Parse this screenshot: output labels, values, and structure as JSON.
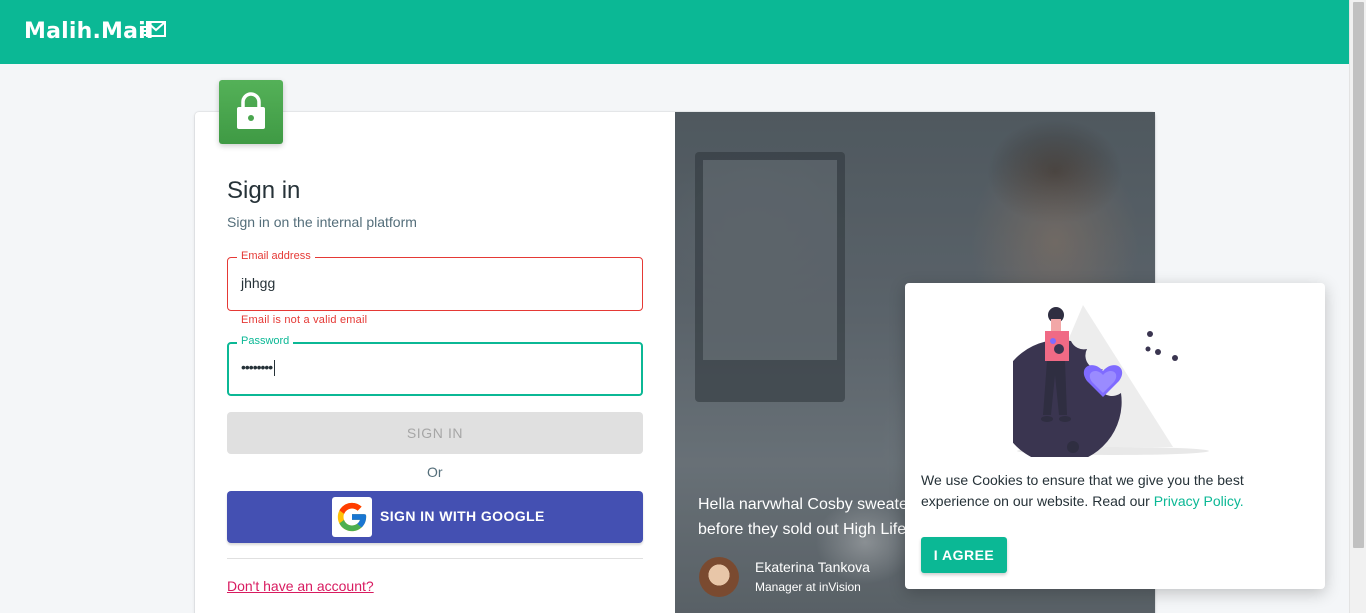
{
  "header": {
    "brand": "Malih.Mail",
    "brand_icon": "mail-send-icon",
    "background": "#0bb895"
  },
  "login": {
    "lock_icon": "lock-icon",
    "title": "Sign in",
    "subtitle": "Sign in on the internal platform",
    "email": {
      "label": "Email address",
      "value": "jhhgg",
      "error": "Email is not a valid email"
    },
    "password": {
      "label": "Password",
      "value": "••••••••"
    },
    "sign_in_label": "SIGN IN",
    "or_label": "Or",
    "google_label": "SIGN IN WITH GOOGLE",
    "google_icon": "google-icon",
    "signup_link": "Don't have an account?"
  },
  "testimonial": {
    "quote": "Hella narvwhal Cosby sweater McSweeney's, salvia kitsch before they sold out High Life.",
    "author_name": "Ekaterina Tankova",
    "author_role": "Manager at inVision"
  },
  "cookie_banner": {
    "text_before_link": "We use Cookies to ensure that we give you the best experience on our website. Read our ",
    "link_text": "Privacy Policy",
    "text_after_link": ".",
    "agree_label": "I AGREE"
  },
  "colors": {
    "accent": "#0bb895",
    "error": "#e53935",
    "google_button": "#4450b2",
    "link": "#d81b60"
  }
}
